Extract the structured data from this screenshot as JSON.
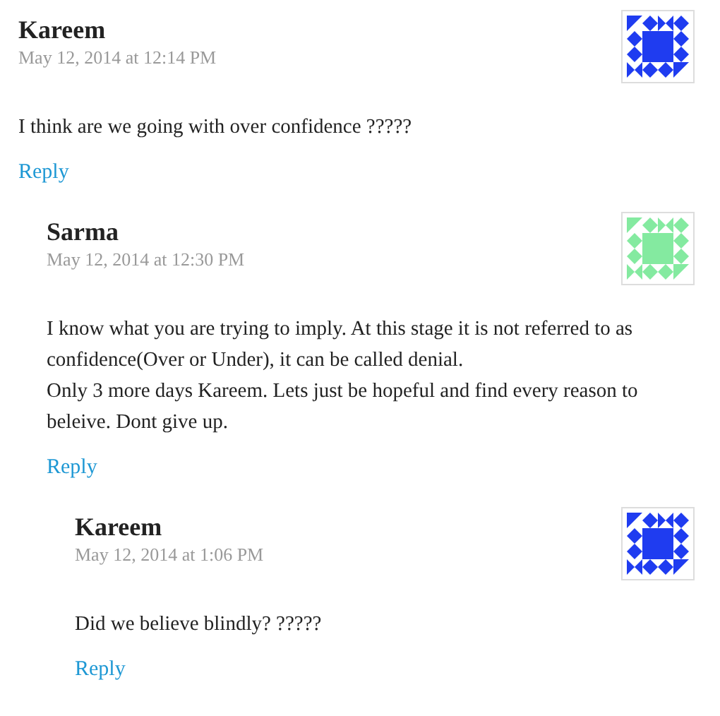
{
  "comments": [
    {
      "author": "Kareem",
      "date": "May 12, 2014 at 12:14 PM",
      "color": "#1f3cf0",
      "paragraphs": [
        "I think are we going with over confidence ?????"
      ],
      "reply": "Reply",
      "children": [
        {
          "author": "Sarma",
          "date": "May 12, 2014 at 12:30 PM",
          "color": "#84eaa0",
          "paragraphs": [
            "I know what you are trying to imply. At this stage it is not referred to as confidence(Over or Under), it can be called denial.\nOnly 3 more days Kareem. Lets just be hopeful and find every reason to beleive. Dont give up."
          ],
          "reply": "Reply",
          "children": [
            {
              "author": "Kareem",
              "date": "May 12, 2014 at 1:06 PM",
              "color": "#1f3cf0",
              "paragraphs": [
                "Did we believe blindly? ?????"
              ],
              "reply": "Reply"
            }
          ]
        }
      ]
    }
  ]
}
